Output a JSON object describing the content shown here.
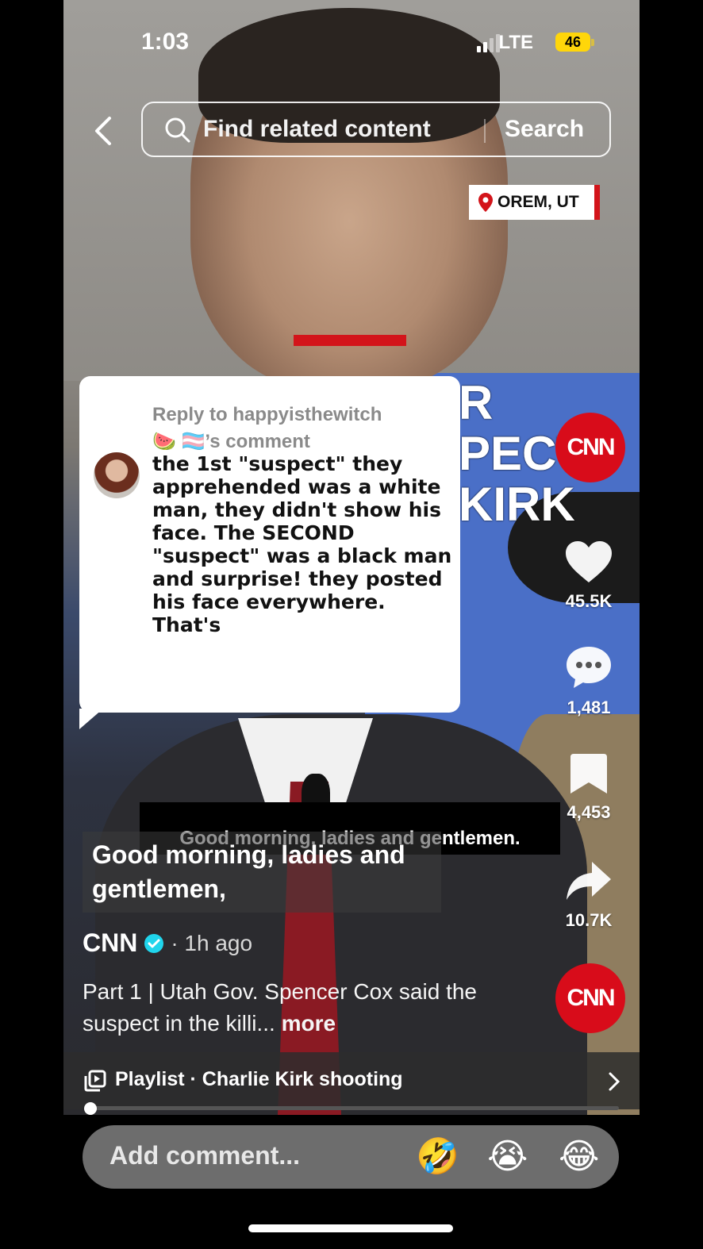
{
  "status_bar": {
    "time": "1:03",
    "network": "LTE",
    "battery": "46"
  },
  "search": {
    "placeholder": "Find related content",
    "button": "Search"
  },
  "video": {
    "location": "OREM, UT",
    "headline_lines": [
      "R",
      "PECT",
      "KIRK"
    ],
    "burned_subtitle": "Good morning, ladies and gentlemen."
  },
  "reply_card": {
    "reply_to": "Reply to happyisthewitch",
    "reply_to_line2": "🍉 🏳️‍⚧️’s comment",
    "comment_text": "the 1st \"suspect\" they apprehended was a white man, they didn't show his face. The SECOND \"suspect\" was a black man and surprise! they posted his face everywhere. That's"
  },
  "actions": {
    "channel_logo": "CNN",
    "likes": "45.5K",
    "comments": "1,481",
    "saves": "4,453",
    "shares": "10.7K",
    "sound_logo": "CNN"
  },
  "caption": "Good morning, ladies and gentlemen,",
  "post": {
    "author": "CNN",
    "time_ago": "· 1h ago",
    "description": "Part 1 | Utah Gov. Spencer Cox said the suspect in the killi...",
    "more": "more"
  },
  "playlist": {
    "label": "Playlist · Charlie Kirk shooting",
    "progress": 0.01
  },
  "comment_bar": {
    "placeholder": "Add comment...",
    "emojis": [
      "🤣",
      "😭",
      "😂"
    ]
  },
  "icons": [
    "back-icon",
    "search-icon",
    "location-pin-icon",
    "heart-icon",
    "comment-icon",
    "bookmark-icon",
    "share-icon",
    "playlist-icon",
    "chevron-right-icon",
    "verified-icon"
  ]
}
